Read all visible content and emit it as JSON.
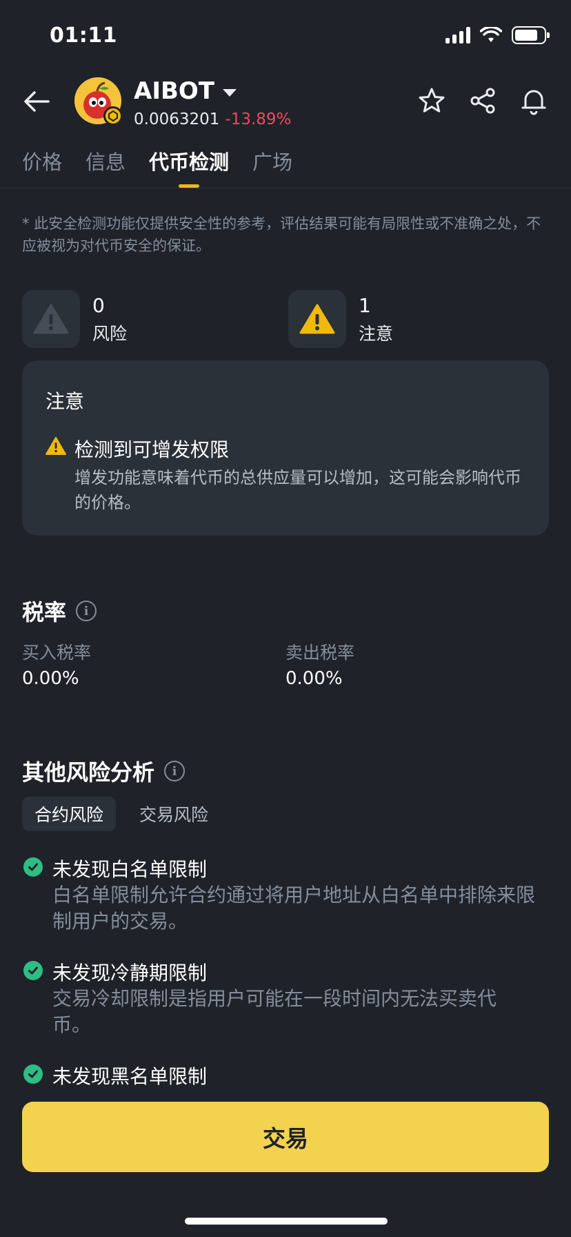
{
  "status_bar": {
    "time": "01:11"
  },
  "header": {
    "token_name": "AIBOT",
    "price": "0.0063201",
    "change": "-13.89%"
  },
  "tabs": [
    {
      "label": "价格"
    },
    {
      "label": "信息"
    },
    {
      "label": "代币检测",
      "active": true
    },
    {
      "label": "广场"
    }
  ],
  "disclaimer": "* 此安全检测功能仅提供安全性的参考，评估结果可能有局限性或不准确之处，不应被视为对代币安全的保证。",
  "summary": {
    "risk": {
      "count": "0",
      "label": "风险"
    },
    "caution": {
      "count": "1",
      "label": "注意"
    }
  },
  "notice": {
    "title": "注意",
    "item_title": "检测到可增发权限",
    "item_desc": "增发功能意味着代币的总供应量可以增加，这可能会影响代币的价格。"
  },
  "tax": {
    "title": "税率",
    "buy_label": "买入税率",
    "buy_value": "0.00%",
    "sell_label": "卖出税率",
    "sell_value": "0.00%"
  },
  "other_risk": {
    "title": "其他风险分析",
    "tabs": [
      "合约风险",
      "交易风险"
    ],
    "items": [
      {
        "title": "未发现白名单限制",
        "desc": "白名单限制允许合约通过将用户地址从白名单中排除来限制用户的交易。"
      },
      {
        "title": "未发现冷静期限制",
        "desc": "交易冷却限制是指用户可能在一段时间内无法买卖代币。"
      },
      {
        "title": "未发现黑名单限制",
        "desc": ""
      }
    ]
  },
  "trade_button": "交易",
  "colors": {
    "background": "#1f2229",
    "card": "#2b3139",
    "accent": "#f0b90b",
    "negative": "#f6465d",
    "positive": "#2ebd85",
    "button": "#f3d24f"
  }
}
